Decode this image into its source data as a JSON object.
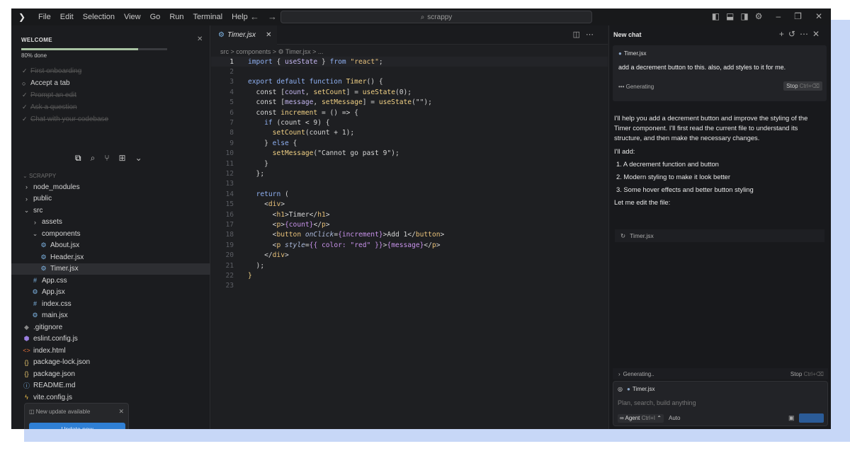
{
  "menu": [
    "File",
    "Edit",
    "Selection",
    "View",
    "Go",
    "Run",
    "Terminal",
    "Help"
  ],
  "search_text": "scrappy",
  "welcome": {
    "title": "WELCOME",
    "progress_text": "80% done",
    "progress_pct": 80,
    "items": [
      {
        "label": "First onboarding",
        "done": true
      },
      {
        "label": "Accept a tab",
        "done": false
      },
      {
        "label": "Prompt an edit",
        "done": true
      },
      {
        "label": "Ask a question",
        "done": true
      },
      {
        "label": "Chat with your codebase",
        "done": true
      }
    ]
  },
  "explorer": {
    "project": "SCRAPPY",
    "rows": [
      {
        "label": "node_modules",
        "indent": 1,
        "icon": "chevron-right"
      },
      {
        "label": "public",
        "indent": 1,
        "icon": "chevron-right"
      },
      {
        "label": "src",
        "indent": 1,
        "icon": "chevron-down"
      },
      {
        "label": "assets",
        "indent": 2,
        "icon": "chevron-right"
      },
      {
        "label": "components",
        "indent": 2,
        "icon": "chevron-down"
      },
      {
        "label": "About.jsx",
        "indent": 3,
        "icon": "react"
      },
      {
        "label": "Header.jsx",
        "indent": 3,
        "icon": "react"
      },
      {
        "label": "Timer.jsx",
        "indent": 3,
        "icon": "react",
        "selected": true
      },
      {
        "label": "App.css",
        "indent": 2,
        "icon": "css"
      },
      {
        "label": "App.jsx",
        "indent": 2,
        "icon": "react"
      },
      {
        "label": "index.css",
        "indent": 2,
        "icon": "css"
      },
      {
        "label": "main.jsx",
        "indent": 2,
        "icon": "react"
      },
      {
        "label": ".gitignore",
        "indent": 1,
        "icon": "git"
      },
      {
        "label": "eslint.config.js",
        "indent": 1,
        "icon": "eslint"
      },
      {
        "label": "index.html",
        "indent": 1,
        "icon": "html"
      },
      {
        "label": "package-lock.json",
        "indent": 1,
        "icon": "json"
      },
      {
        "label": "package.json",
        "indent": 1,
        "icon": "json"
      },
      {
        "label": "README.md",
        "indent": 1,
        "icon": "info"
      },
      {
        "label": "vite.config.js",
        "indent": 1,
        "icon": "vite"
      }
    ]
  },
  "notification": {
    "text": "New update available",
    "button": "Update now"
  },
  "editor": {
    "tab": "Timer.jsx",
    "breadcrumb": "src > components > ⚙ Timer.jsx > ...",
    "lines": [
      [
        [
          "kw",
          "import "
        ],
        [
          "pl",
          "{ "
        ],
        [
          "var",
          "useState"
        ],
        [
          "pl",
          " } "
        ],
        [
          "kw",
          "from "
        ],
        [
          "str",
          "\"react\""
        ],
        [
          "pl",
          ";"
        ]
      ],
      [],
      [
        [
          "kw",
          "export default function "
        ],
        [
          "fn",
          "Timer"
        ],
        [
          "pl",
          "() {"
        ]
      ],
      [
        [
          "pl",
          "  const ["
        ],
        [
          "var",
          "count"
        ],
        [
          "pl",
          ", "
        ],
        [
          "fn",
          "setCount"
        ],
        [
          "pl",
          "] = "
        ],
        [
          "fn",
          "useState"
        ],
        [
          "pl",
          "(0);"
        ]
      ],
      [
        [
          "pl",
          "  const ["
        ],
        [
          "var",
          "message"
        ],
        [
          "pl",
          ", "
        ],
        [
          "fn",
          "setMessage"
        ],
        [
          "pl",
          "] = "
        ],
        [
          "fn",
          "useState"
        ],
        [
          "pl",
          "(\"\");"
        ]
      ],
      [
        [
          "pl",
          "  const "
        ],
        [
          "fn",
          "increment"
        ],
        [
          "pl",
          " = () => {"
        ]
      ],
      [
        [
          "pl",
          "    "
        ],
        [
          "kw",
          "if "
        ],
        [
          "pl",
          "(count < 9) {"
        ]
      ],
      [
        [
          "pl",
          "      "
        ],
        [
          "fn",
          "setCount"
        ],
        [
          "pl",
          "(count + 1);"
        ]
      ],
      [
        [
          "pl",
          "    } "
        ],
        [
          "kw",
          "else "
        ],
        [
          "pl",
          "{"
        ]
      ],
      [
        [
          "pl",
          "      "
        ],
        [
          "fn",
          "setMessage"
        ],
        [
          "pl",
          "(\"Cannot go past 9\");"
        ]
      ],
      [
        [
          "pl",
          "    }"
        ]
      ],
      [
        [
          "pl",
          "  };"
        ]
      ],
      [],
      [
        [
          "pl",
          "  "
        ],
        [
          "kw",
          "return "
        ],
        [
          "pl",
          "("
        ]
      ],
      [
        [
          "pl",
          "    <"
        ],
        [
          "tag",
          "div"
        ],
        [
          "pl",
          ">"
        ]
      ],
      [
        [
          "pl",
          "      <"
        ],
        [
          "tag",
          "h1"
        ],
        [
          "pl",
          ">Timer</"
        ],
        [
          "tag",
          "h1"
        ],
        [
          "pl",
          ">"
        ]
      ],
      [
        [
          "pl",
          "      <"
        ],
        [
          "tag",
          "p"
        ],
        [
          "pl",
          ">"
        ],
        [
          "br",
          "{count}"
        ],
        [
          "pl",
          "</"
        ],
        [
          "tag",
          "p"
        ],
        [
          "pl",
          ">"
        ]
      ],
      [
        [
          "pl",
          "      <"
        ],
        [
          "tag",
          "button "
        ],
        [
          "attr",
          "onClick"
        ],
        [
          "pl",
          "="
        ],
        [
          "br",
          "{increment}"
        ],
        [
          "pl",
          ">Add 1</"
        ],
        [
          "tag",
          "button"
        ],
        [
          "pl",
          ">"
        ]
      ],
      [
        [
          "pl",
          "      <"
        ],
        [
          "tag",
          "p "
        ],
        [
          "attr",
          "style"
        ],
        [
          "pl",
          "="
        ],
        [
          "br",
          "{{ color: \"red\" }}"
        ],
        [
          "pl",
          ">"
        ],
        [
          "br",
          "{message}"
        ],
        [
          "pl",
          "</"
        ],
        [
          "tag",
          "p"
        ],
        [
          "pl",
          ">"
        ]
      ],
      [
        [
          "pl",
          "    </"
        ],
        [
          "tag",
          "div"
        ],
        [
          "pl",
          ">"
        ]
      ],
      [
        [
          "pl",
          "  );"
        ]
      ],
      [
        [
          "fn",
          "}"
        ]
      ],
      []
    ]
  },
  "chat": {
    "title": "New chat",
    "context_file": "Timer.jsx",
    "user_message": "add a decrement button to this. also, add styles to it for me.",
    "status": "Generating",
    "stop": "Stop",
    "stop_key": "Ctrl+⌫",
    "response_intro": "I'll help you add a decrement button and improve the styling of the Timer component. I'll first read the current file to understand its structure, and then make the necessary changes.",
    "ill_add": "I'll add:",
    "list": [
      "1. A decrement function and button",
      "2. Modern styling to make it look better",
      "3. Some hover effects and better button styling"
    ],
    "edit_line": "Let me edit the file:",
    "file_chip": "Timer.jsx",
    "bottom_status": "Generating..",
    "input_placeholder": "Plan, search, build anything",
    "agent": "Agent",
    "agent_key": "Ctrl+I",
    "mode": "Auto"
  }
}
